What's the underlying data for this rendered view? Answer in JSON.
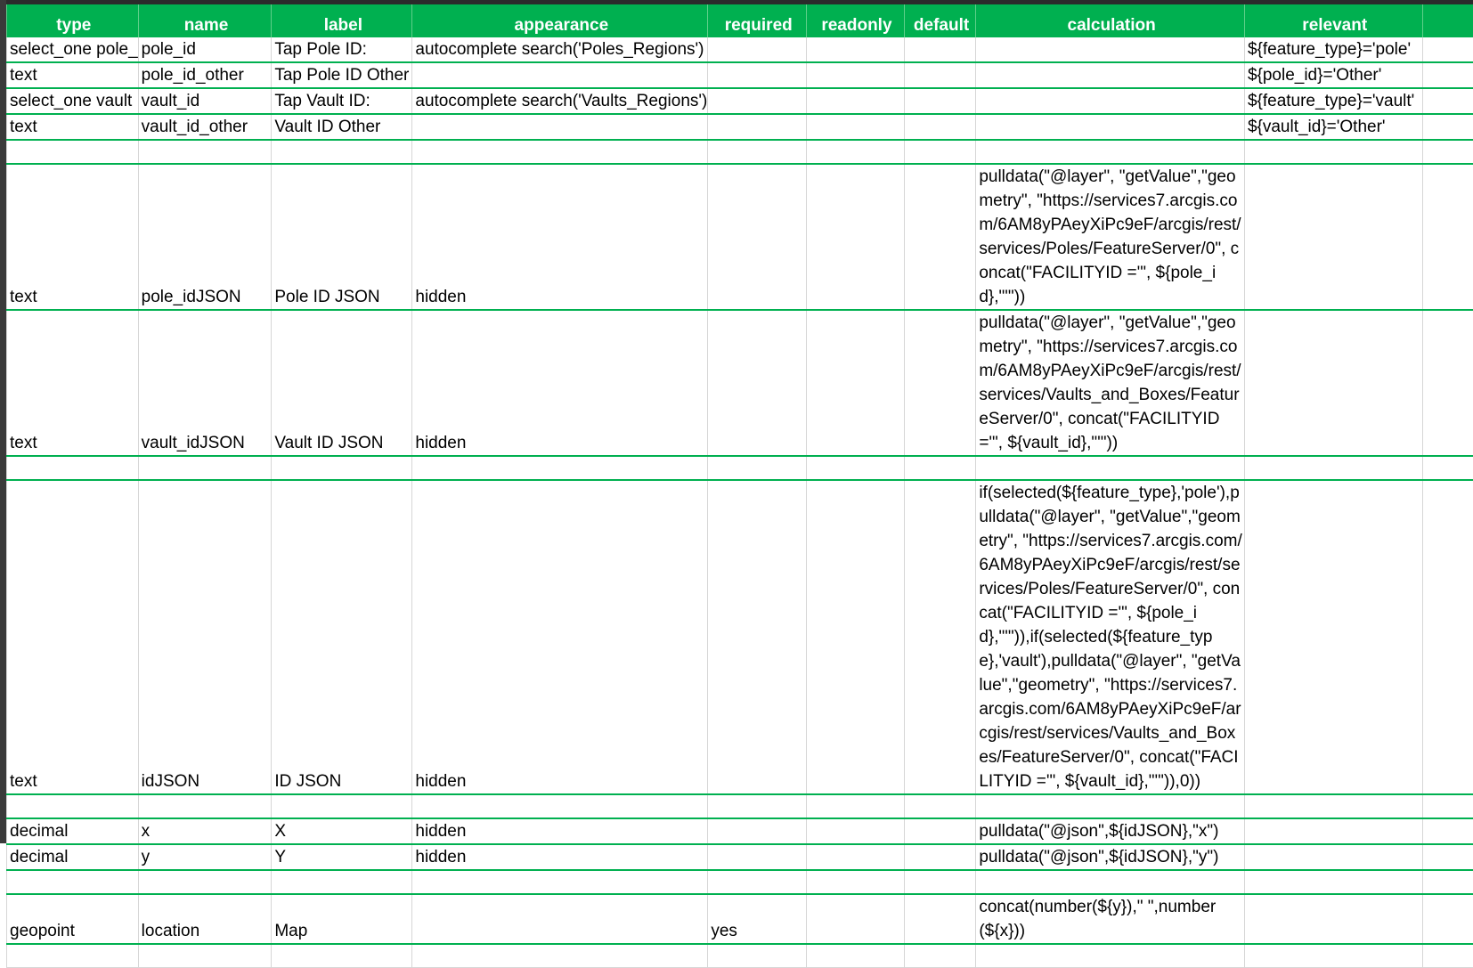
{
  "headers": [
    "type",
    "name",
    "label",
    "appearance",
    "required",
    "readonly",
    "default",
    "calculation",
    "relevant",
    ""
  ],
  "rows": [
    {
      "type": "select_one pole_",
      "name": "pole_id",
      "label": "Tap Pole ID:",
      "appearance": "autocomplete search('Poles_Regions')",
      "required": "",
      "readonly": "",
      "default": "",
      "calculation": "",
      "relevant": "${feature_type}='pole'"
    },
    {
      "type": "text",
      "name": "pole_id_other",
      "label": "Tap Pole ID Other",
      "appearance": "",
      "required": "",
      "readonly": "",
      "default": "",
      "calculation": "",
      "relevant": "${pole_id}='Other'"
    },
    {
      "type": "select_one vault",
      "name": "vault_id",
      "label": "Tap Vault ID:",
      "appearance": "autocomplete search('Vaults_Regions')",
      "required": "",
      "readonly": "",
      "default": "",
      "calculation": "",
      "relevant": "${feature_type}='vault'"
    },
    {
      "type": "text",
      "name": "vault_id_other",
      "label": "Vault ID Other",
      "appearance": "",
      "required": "",
      "readonly": "",
      "default": "",
      "calculation": "",
      "relevant": "${vault_id}='Other'"
    },
    {
      "type": "",
      "name": "",
      "label": "",
      "appearance": "",
      "required": "",
      "readonly": "",
      "default": "",
      "calculation": "",
      "relevant": ""
    },
    {
      "type": "text",
      "name": "pole_idJSON",
      "label": "Pole ID JSON",
      "appearance": "hidden",
      "required": "",
      "readonly": "",
      "default": "",
      "calculation": "pulldata(\"@layer\", \"getValue\",\"geometry\", \"https://services7.arcgis.com/6AM8yPAeyXiPc9eF/arcgis/rest/services/Poles/FeatureServer/0\", concat(\"FACILITYID ='\", ${pole_id},\"'\"))",
      "relevant": ""
    },
    {
      "type": "text",
      "name": "vault_idJSON",
      "label": "Vault ID JSON",
      "appearance": "hidden",
      "required": "",
      "readonly": "",
      "default": "",
      "calculation": "pulldata(\"@layer\", \"getValue\",\"geometry\", \"https://services7.arcgis.com/6AM8yPAeyXiPc9eF/arcgis/rest/services/Vaults_and_Boxes/FeatureServer/0\", concat(\"FACILITYID ='\", ${vault_id},\"'\"))",
      "relevant": ""
    },
    {
      "type": "",
      "name": "",
      "label": "",
      "appearance": "",
      "required": "",
      "readonly": "",
      "default": "",
      "calculation": "",
      "relevant": ""
    },
    {
      "type": "text",
      "name": "idJSON",
      "label": "ID JSON",
      "appearance": "hidden",
      "required": "",
      "readonly": "",
      "default": "",
      "calculation": "if(selected(${feature_type},'pole'),pulldata(\"@layer\", \"getValue\",\"geometry\", \"https://services7.arcgis.com/6AM8yPAeyXiPc9eF/arcgis/rest/services/Poles/FeatureServer/0\", concat(\"FACILITYID ='\", ${pole_id},\"'\")),if(selected(${feature_type},'vault'),pulldata(\"@layer\", \"getValue\",\"geometry\", \"https://services7.arcgis.com/6AM8yPAeyXiPc9eF/arcgis/rest/services/Vaults_and_Boxes/FeatureServer/0\", concat(\"FACILITYID ='\", ${vault_id},\"'\")),0))",
      "relevant": ""
    },
    {
      "type": "",
      "name": "",
      "label": "",
      "appearance": "",
      "required": "",
      "readonly": "",
      "default": "",
      "calculation": "",
      "relevant": ""
    },
    {
      "type": "decimal",
      "name": "x",
      "label": "X",
      "appearance": "hidden",
      "required": "",
      "readonly": "",
      "default": "",
      "calculation": "pulldata(\"@json\",${idJSON},\"x\")",
      "relevant": ""
    },
    {
      "type": "decimal",
      "name": "y",
      "label": "Y",
      "appearance": "hidden",
      "required": "",
      "readonly": "",
      "default": "",
      "calculation": "pulldata(\"@json\",${idJSON},\"y\")",
      "relevant": ""
    },
    {
      "type": "",
      "name": "",
      "label": "",
      "appearance": "",
      "required": "",
      "readonly": "",
      "default": "",
      "calculation": "",
      "relevant": ""
    },
    {
      "type": "geopoint",
      "name": "location",
      "label": "Map",
      "appearance": "",
      "required": "yes",
      "readonly": "",
      "default": "",
      "calculation": "concat(number(${y}),\" \",number(${x}))",
      "relevant": ""
    },
    {
      "type": "",
      "name": "",
      "label": "",
      "appearance": "",
      "required": "",
      "readonly": "",
      "default": "",
      "calculation": "",
      "relevant": ""
    }
  ],
  "colors": {
    "header_bg": "#00b050",
    "header_text": "#ffffff",
    "row_border": "#00b050"
  }
}
